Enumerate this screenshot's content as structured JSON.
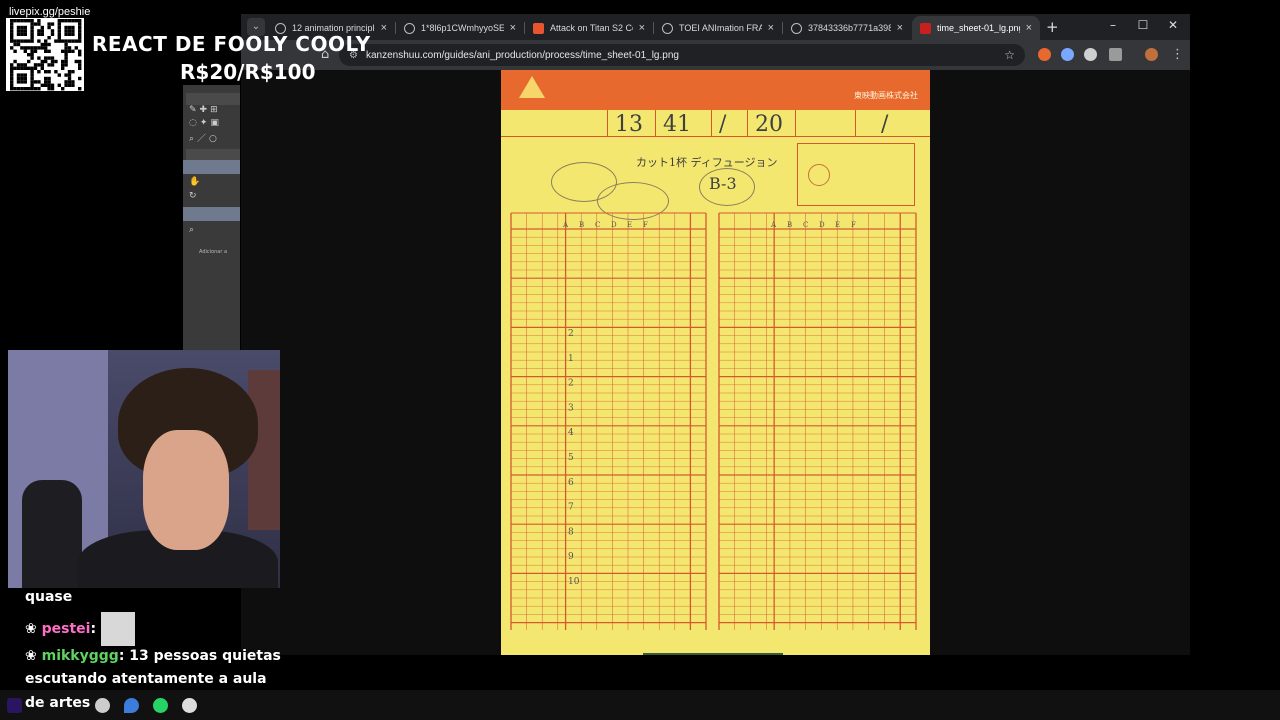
{
  "overlay": {
    "qr_label": "livepix.gg/peshie",
    "title": "REACT DE FOOLY COOLY",
    "price": "R$20/R$100"
  },
  "browser": {
    "tabs": [
      {
        "label": "12 animation principles",
        "icon": "chrome-icon"
      },
      {
        "label": "1*8l6p1CWmhyyoSEXV",
        "icon": "globe-icon"
      },
      {
        "label": "Attack on Titan S2 Comp",
        "icon": "crunchyroll-icon"
      },
      {
        "label": "TOEI ANImation FRAME",
        "icon": "chrome-icon"
      },
      {
        "label": "37843336b7771a3988c",
        "icon": "globe-icon"
      },
      {
        "label": "time_sheet-01_lg.png (",
        "icon": "image-icon"
      }
    ],
    "active_tab": 5,
    "url": "kanzenshuu.com/guides/ani_production/process/time_sheet-01_lg.png",
    "window_controls": [
      "–",
      "☐",
      "✕"
    ],
    "new_tab": "+"
  },
  "sheet": {
    "company": "東映動画株式会社",
    "cut_numbers": [
      "13",
      "41",
      "/",
      "20",
      "/"
    ],
    "cut_label": "カット1杯 ディフュージョン",
    "scene": "B-3",
    "col_letters": [
      "A",
      "B",
      "C",
      "D",
      "E",
      "F"
    ],
    "frame_numbers": [
      "2",
      "1",
      "2",
      "3",
      "4",
      "5",
      "6",
      "7",
      "8",
      "9",
      "10"
    ]
  },
  "side_panel": {
    "label": "Adicionar a"
  },
  "chat": {
    "line0": "quase",
    "user1": "pestei",
    "user2": "mikkyggg",
    "msg2a": "13 pessoas quietas",
    "msg2b": "escutando atentamente a aula",
    "msg3": "de artes"
  },
  "colors": {
    "sheet_yellow": "#f4e770",
    "sheet_orange": "#e8692e",
    "grid_red": "#d5582e",
    "user1": "#ff6ec7",
    "user2": "#5fd35f"
  }
}
